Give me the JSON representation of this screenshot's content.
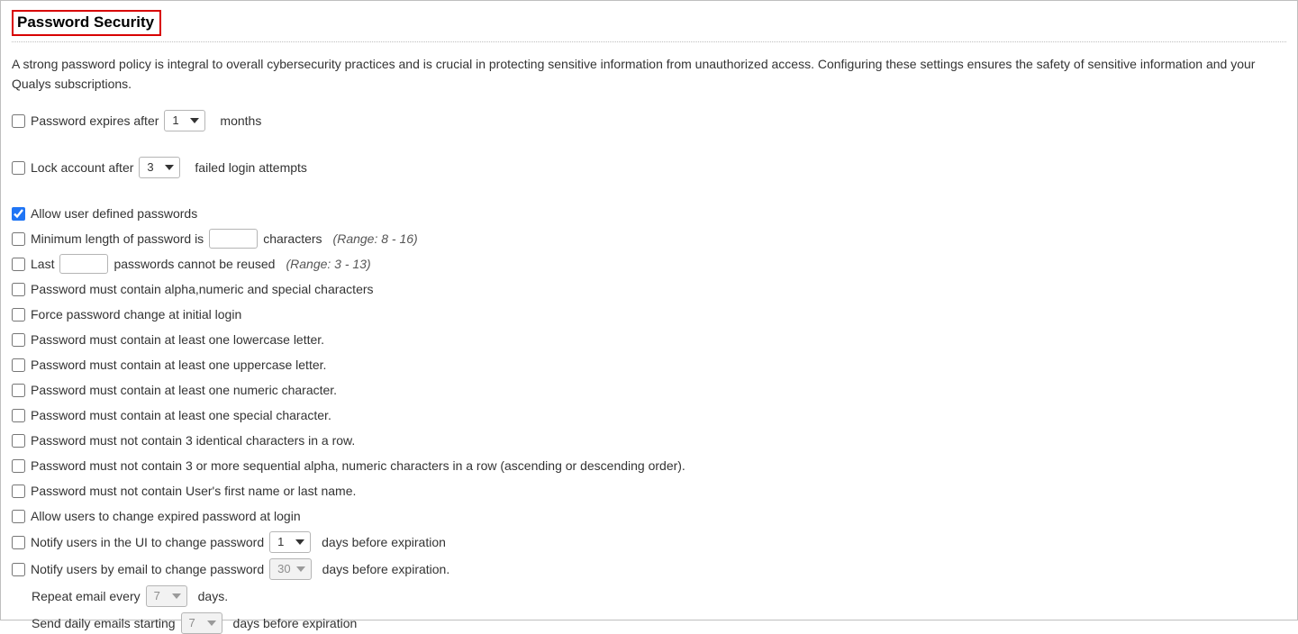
{
  "title": "Password Security",
  "intro": "A strong password policy is integral to overall cybersecurity practices and is crucial in protecting sensitive information from unauthorized access. Configuring these settings ensures the safety of sensitive information and your Qualys subscriptions.",
  "expire": {
    "label": "Password expires after",
    "value": "1",
    "suffix": "months"
  },
  "lock": {
    "label": "Lock account after",
    "value": "3",
    "suffix": "failed login attempts"
  },
  "allow_user_defined": "Allow user defined passwords",
  "min_len": {
    "pre": "Minimum length of password is",
    "suffix": "characters",
    "hint": "(Range: 8 - 16)"
  },
  "last_pw": {
    "pre": "Last",
    "suffix": "passwords cannot be reused",
    "hint": "(Range: 3 - 13)"
  },
  "alpha_num_special": "Password must contain alpha,numeric and special characters",
  "force_initial": "Force password change at initial login",
  "one_lower": "Password must contain at least one lowercase letter.",
  "one_upper": "Password must contain at least one uppercase letter.",
  "one_numeric": "Password must contain at least one numeric character.",
  "one_special": "Password must contain at least one special character.",
  "no_3_identical": "Password must not contain 3 identical characters in a row.",
  "no_3_seq": "Password must not contain 3 or more sequential alpha, numeric characters in a row (ascending or descending order).",
  "no_name": "Password must not contain User's first name or last name.",
  "change_expired": "Allow users to change expired password at login",
  "notify_ui": {
    "pre": "Notify users in the UI to change password",
    "value": "1",
    "suffix": "days before expiration"
  },
  "notify_email": {
    "pre": "Notify users by email to change password",
    "value": "30",
    "suffix": "days before expiration."
  },
  "repeat_email": {
    "pre": "Repeat email every",
    "value": "7",
    "suffix": "days."
  },
  "daily_emails": {
    "pre": "Send daily emails starting",
    "value": "7",
    "suffix": "days before expiration"
  }
}
